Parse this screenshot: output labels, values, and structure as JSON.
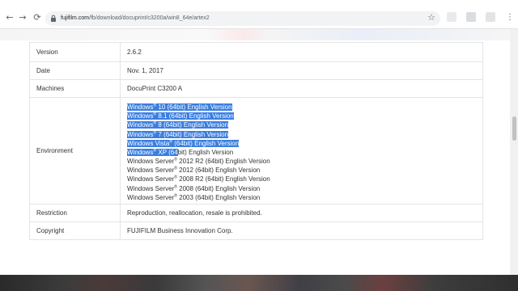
{
  "browser": {
    "nav": {
      "back_icon": "←",
      "forward_icon": "→",
      "reload_icon": "⟳",
      "star_icon": "☆",
      "menu_icon": "⋮"
    },
    "url_host": "fujifilm.com",
    "url_path": "/fb/download/docuprint/c3200a/win8_64e/artex2"
  },
  "details": {
    "version": {
      "label": "Version",
      "value": "2.6.2"
    },
    "date": {
      "label": "Date",
      "value": "Nov. 1, 2017"
    },
    "machines": {
      "label": "Machines",
      "value": "DocuPrint C3200 A"
    },
    "environment": {
      "label": "Environment",
      "items": [
        {
          "name": "Windows",
          "sup": "®",
          "rest": " 10 (64bit) English Version",
          "selected": "full"
        },
        {
          "name": "Windows",
          "sup": "®",
          "rest": " 8.1 (64bit) English Version",
          "selected": "full"
        },
        {
          "name": "Windows",
          "sup": "®",
          "rest": " 8 (64bit) English Version",
          "selected": "full"
        },
        {
          "name": "Windows",
          "sup": "®",
          "rest": " 7 (64bit) English Version",
          "selected": "full"
        },
        {
          "name": "Windows Vista",
          "sup": "®",
          "rest": " (64bit) English Version",
          "selected": "full"
        },
        {
          "name": "Windows",
          "sup": "®",
          "rest": " XP (64bit) English Version",
          "selected": "partial",
          "selected_chars": 7
        },
        {
          "name": "Windows Server",
          "sup": "®",
          "rest": " 2012 R2 (64bit) English Version",
          "selected": "none"
        },
        {
          "name": "Windows Server",
          "sup": "®",
          "rest": " 2012 (64bit) English Version",
          "selected": "none"
        },
        {
          "name": "Windows Server",
          "sup": "®",
          "rest": " 2008 R2 (64bit) English Version",
          "selected": "none"
        },
        {
          "name": "Windows Server",
          "sup": "®",
          "rest": " 2008 (64bit) English Version",
          "selected": "none"
        },
        {
          "name": "Windows Server",
          "sup": "®",
          "rest": " 2003 (64bit) English Version",
          "selected": "none"
        }
      ]
    },
    "restriction": {
      "label": "Restriction",
      "value": "Reproduction, reallocation, resale is prohibited."
    },
    "copyright": {
      "label": "Copyright",
      "value": "FUJIFILM Business Innovation Corp."
    }
  },
  "colors": {
    "selection": "#3a7ee0",
    "border": "#e4e4e4"
  }
}
